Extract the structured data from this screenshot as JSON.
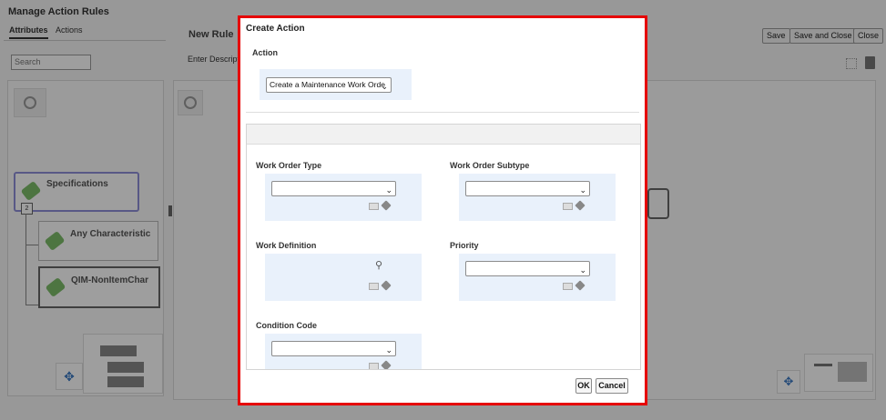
{
  "background": {
    "title": "Manage Action Rules",
    "tabs": [
      {
        "label": "Attributes"
      },
      {
        "label": "Actions"
      }
    ],
    "search_placeholder": "Search",
    "rule_title": "New Rule",
    "rule_desc": "Enter Descript",
    "tree": {
      "root": "Specifications",
      "count": "2",
      "children": [
        "Any Characteristic",
        "QIM-NonItemChar"
      ]
    },
    "buttons": {
      "save": "Save",
      "save_close": "Save and Close",
      "close": "Close"
    }
  },
  "dialog": {
    "title": "Create Action",
    "action_label": "Action",
    "action_value": "Create a Maintenance Work Orde",
    "fields": {
      "work_order_type": {
        "label": "Work Order Type",
        "value": ""
      },
      "work_order_subtype": {
        "label": "Work Order Subtype",
        "value": ""
      },
      "work_definition": {
        "label": "Work Definition",
        "value": ""
      },
      "priority": {
        "label": "Priority",
        "value": ""
      },
      "condition_code": {
        "label": "Condition Code",
        "value": ""
      }
    },
    "ok_label": "OK",
    "cancel_label": "Cancel"
  },
  "colors": {
    "highlight_border": "#e60000",
    "field_bg": "#e9f1fb",
    "tag_green": "#7dbd6a"
  }
}
